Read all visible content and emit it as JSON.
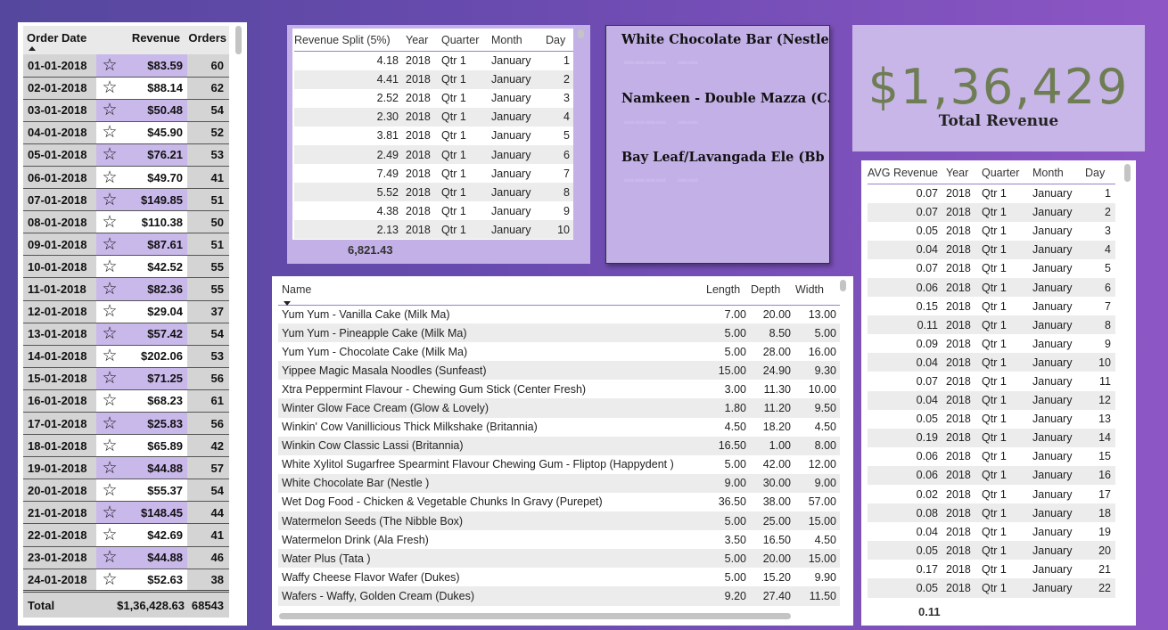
{
  "orders_table": {
    "headers": {
      "date": "Order Date",
      "revenue": "Revenue",
      "orders": "Orders"
    },
    "rows": [
      {
        "date": "01-01-2018",
        "revenue": "$83.59",
        "orders": "60",
        "highlight": true
      },
      {
        "date": "02-01-2018",
        "revenue": "$88.14",
        "orders": "62",
        "highlight": false
      },
      {
        "date": "03-01-2018",
        "revenue": "$50.48",
        "orders": "54",
        "highlight": true
      },
      {
        "date": "04-01-2018",
        "revenue": "$45.90",
        "orders": "52",
        "highlight": false
      },
      {
        "date": "05-01-2018",
        "revenue": "$76.21",
        "orders": "53",
        "highlight": true
      },
      {
        "date": "06-01-2018",
        "revenue": "$49.70",
        "orders": "41",
        "highlight": false
      },
      {
        "date": "07-01-2018",
        "revenue": "$149.85",
        "orders": "51",
        "highlight": true
      },
      {
        "date": "08-01-2018",
        "revenue": "$110.38",
        "orders": "50",
        "highlight": false
      },
      {
        "date": "09-01-2018",
        "revenue": "$87.61",
        "orders": "51",
        "highlight": true
      },
      {
        "date": "10-01-2018",
        "revenue": "$42.52",
        "orders": "55",
        "highlight": false
      },
      {
        "date": "11-01-2018",
        "revenue": "$82.36",
        "orders": "55",
        "highlight": true
      },
      {
        "date": "12-01-2018",
        "revenue": "$29.04",
        "orders": "37",
        "highlight": false
      },
      {
        "date": "13-01-2018",
        "revenue": "$57.42",
        "orders": "54",
        "highlight": true
      },
      {
        "date": "14-01-2018",
        "revenue": "$202.06",
        "orders": "53",
        "highlight": false
      },
      {
        "date": "15-01-2018",
        "revenue": "$71.25",
        "orders": "56",
        "highlight": true
      },
      {
        "date": "16-01-2018",
        "revenue": "$68.23",
        "orders": "61",
        "highlight": false
      },
      {
        "date": "17-01-2018",
        "revenue": "$25.83",
        "orders": "56",
        "highlight": true
      },
      {
        "date": "18-01-2018",
        "revenue": "$65.89",
        "orders": "42",
        "highlight": false
      },
      {
        "date": "19-01-2018",
        "revenue": "$44.88",
        "orders": "57",
        "highlight": true
      },
      {
        "date": "20-01-2018",
        "revenue": "$55.37",
        "orders": "54",
        "highlight": false
      },
      {
        "date": "21-01-2018",
        "revenue": "$148.45",
        "orders": "44",
        "highlight": true
      },
      {
        "date": "22-01-2018",
        "revenue": "$42.69",
        "orders": "41",
        "highlight": false
      },
      {
        "date": "23-01-2018",
        "revenue": "$44.88",
        "orders": "46",
        "highlight": true
      },
      {
        "date": "24-01-2018",
        "revenue": "$52.63",
        "orders": "38",
        "highlight": false
      }
    ],
    "total": {
      "label": "Total",
      "revenue": "$1,36,428.63",
      "orders": "68543"
    }
  },
  "split_table": {
    "headers": {
      "split": "Revenue Split (5%)",
      "year": "Year",
      "quarter": "Quarter",
      "month": "Month",
      "day": "Day"
    },
    "rows": [
      {
        "split": "4.18",
        "year": "2018",
        "quarter": "Qtr 1",
        "month": "January",
        "day": "1"
      },
      {
        "split": "4.41",
        "year": "2018",
        "quarter": "Qtr 1",
        "month": "January",
        "day": "2"
      },
      {
        "split": "2.52",
        "year": "2018",
        "quarter": "Qtr 1",
        "month": "January",
        "day": "3"
      },
      {
        "split": "2.30",
        "year": "2018",
        "quarter": "Qtr 1",
        "month": "January",
        "day": "4"
      },
      {
        "split": "3.81",
        "year": "2018",
        "quarter": "Qtr 1",
        "month": "January",
        "day": "5"
      },
      {
        "split": "2.49",
        "year": "2018",
        "quarter": "Qtr 1",
        "month": "January",
        "day": "6"
      },
      {
        "split": "7.49",
        "year": "2018",
        "quarter": "Qtr 1",
        "month": "January",
        "day": "7"
      },
      {
        "split": "5.52",
        "year": "2018",
        "quarter": "Qtr 1",
        "month": "January",
        "day": "8"
      },
      {
        "split": "4.38",
        "year": "2018",
        "quarter": "Qtr 1",
        "month": "January",
        "day": "9"
      },
      {
        "split": "2.13",
        "year": "2018",
        "quarter": "Qtr 1",
        "month": "January",
        "day": "10"
      }
    ],
    "total": "6,821.43"
  },
  "name_card": {
    "items": [
      "White Chocolate Bar (Nestle )",
      "Namkeen - Double Mazza (C...",
      "Bay Leaf/Lavangada Ele (Bb ..."
    ]
  },
  "kpi": {
    "value": "$1,36,429",
    "label": "Total Revenue"
  },
  "avg_table": {
    "headers": {
      "avg": "AVG Revenue",
      "year": "Year",
      "quarter": "Quarter",
      "month": "Month",
      "day": "Day"
    },
    "rows": [
      {
        "avg": "0.07",
        "year": "2018",
        "quarter": "Qtr 1",
        "month": "January",
        "day": "1"
      },
      {
        "avg": "0.07",
        "year": "2018",
        "quarter": "Qtr 1",
        "month": "January",
        "day": "2"
      },
      {
        "avg": "0.05",
        "year": "2018",
        "quarter": "Qtr 1",
        "month": "January",
        "day": "3"
      },
      {
        "avg": "0.04",
        "year": "2018",
        "quarter": "Qtr 1",
        "month": "January",
        "day": "4"
      },
      {
        "avg": "0.07",
        "year": "2018",
        "quarter": "Qtr 1",
        "month": "January",
        "day": "5"
      },
      {
        "avg": "0.06",
        "year": "2018",
        "quarter": "Qtr 1",
        "month": "January",
        "day": "6"
      },
      {
        "avg": "0.15",
        "year": "2018",
        "quarter": "Qtr 1",
        "month": "January",
        "day": "7"
      },
      {
        "avg": "0.11",
        "year": "2018",
        "quarter": "Qtr 1",
        "month": "January",
        "day": "8"
      },
      {
        "avg": "0.09",
        "year": "2018",
        "quarter": "Qtr 1",
        "month": "January",
        "day": "9"
      },
      {
        "avg": "0.04",
        "year": "2018",
        "quarter": "Qtr 1",
        "month": "January",
        "day": "10"
      },
      {
        "avg": "0.07",
        "year": "2018",
        "quarter": "Qtr 1",
        "month": "January",
        "day": "11"
      },
      {
        "avg": "0.04",
        "year": "2018",
        "quarter": "Qtr 1",
        "month": "January",
        "day": "12"
      },
      {
        "avg": "0.05",
        "year": "2018",
        "quarter": "Qtr 1",
        "month": "January",
        "day": "13"
      },
      {
        "avg": "0.19",
        "year": "2018",
        "quarter": "Qtr 1",
        "month": "January",
        "day": "14"
      },
      {
        "avg": "0.06",
        "year": "2018",
        "quarter": "Qtr 1",
        "month": "January",
        "day": "15"
      },
      {
        "avg": "0.06",
        "year": "2018",
        "quarter": "Qtr 1",
        "month": "January",
        "day": "16"
      },
      {
        "avg": "0.02",
        "year": "2018",
        "quarter": "Qtr 1",
        "month": "January",
        "day": "17"
      },
      {
        "avg": "0.08",
        "year": "2018",
        "quarter": "Qtr 1",
        "month": "January",
        "day": "18"
      },
      {
        "avg": "0.04",
        "year": "2018",
        "quarter": "Qtr 1",
        "month": "January",
        "day": "19"
      },
      {
        "avg": "0.05",
        "year": "2018",
        "quarter": "Qtr 1",
        "month": "January",
        "day": "20"
      },
      {
        "avg": "0.17",
        "year": "2018",
        "quarter": "Qtr 1",
        "month": "January",
        "day": "21"
      },
      {
        "avg": "0.05",
        "year": "2018",
        "quarter": "Qtr 1",
        "month": "January",
        "day": "22"
      }
    ],
    "total": "0.11"
  },
  "product_table": {
    "headers": {
      "name": "Name",
      "length": "Length",
      "depth": "Depth",
      "width": "Width"
    },
    "rows": [
      {
        "name": "Yum Yum - Vanilla Cake (Milk Ma)",
        "length": "7.00",
        "depth": "20.00",
        "width": "13.00"
      },
      {
        "name": "Yum Yum - Pineapple Cake (Milk Ma)",
        "length": "5.00",
        "depth": "8.50",
        "width": "5.00"
      },
      {
        "name": "Yum Yum - Chocolate Cake (Milk Ma)",
        "length": "5.00",
        "depth": "28.00",
        "width": "16.00"
      },
      {
        "name": "Yippee Magic Masala Noodles (Sunfeast)",
        "length": "15.00",
        "depth": "24.90",
        "width": "9.30"
      },
      {
        "name": "Xtra Peppermint Flavour - Chewing Gum Stick (Center Fresh)",
        "length": "3.00",
        "depth": "11.30",
        "width": "10.00"
      },
      {
        "name": "Winter Glow Face Cream (Glow & Lovely)",
        "length": "1.80",
        "depth": "11.20",
        "width": "9.50"
      },
      {
        "name": "Winkin' Cow Vanillicious Thick Milkshake (Britannia)",
        "length": "4.50",
        "depth": "18.20",
        "width": "4.50"
      },
      {
        "name": "Winkin Cow Classic Lassi (Britannia)",
        "length": "16.50",
        "depth": "1.00",
        "width": "8.00"
      },
      {
        "name": "White Xylitol Sugarfree Spearmint Flavour Chewing Gum - Fliptop (Happydent )",
        "length": "5.00",
        "depth": "42.00",
        "width": "12.00"
      },
      {
        "name": "White Chocolate Bar (Nestle )",
        "length": "9.00",
        "depth": "30.00",
        "width": "9.00"
      },
      {
        "name": "Wet Dog Food - Chicken & Vegetable Chunks In Gravy (Purepet)",
        "length": "36.50",
        "depth": "38.00",
        "width": "57.00"
      },
      {
        "name": "Watermelon Seeds (The Nibble Box)",
        "length": "5.00",
        "depth": "25.00",
        "width": "15.00"
      },
      {
        "name": "Watermelon Drink (Ala Fresh)",
        "length": "3.50",
        "depth": "16.50",
        "width": "4.50"
      },
      {
        "name": "Water Plus (Tata )",
        "length": "5.00",
        "depth": "20.00",
        "width": "15.00"
      },
      {
        "name": "Waffy Cheese Flavor Wafer (Dukes)",
        "length": "5.00",
        "depth": "15.20",
        "width": "9.90"
      },
      {
        "name": "Wafers - Waffy, Golden Cream (Dukes)",
        "length": "9.20",
        "depth": "27.40",
        "width": "11.50"
      }
    ]
  }
}
